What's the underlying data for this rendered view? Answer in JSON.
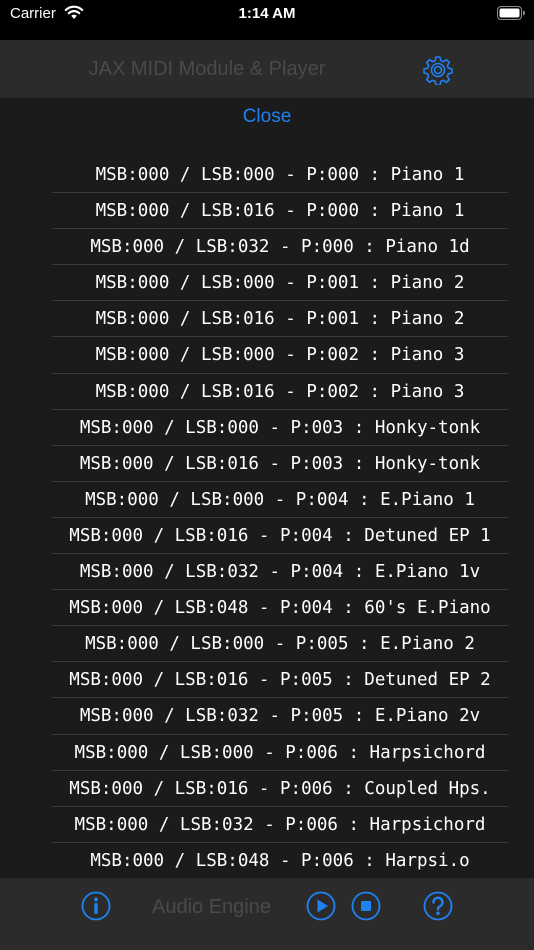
{
  "status_bar": {
    "carrier": "Carrier",
    "time": "1:14 AM"
  },
  "navbar": {
    "title": "JAX MIDI Module & Player"
  },
  "sheet": {
    "close_label": "Close",
    "items": [
      "MSB:000 / LSB:000 - P:000 : Piano 1",
      "MSB:000 / LSB:016 - P:000 : Piano 1",
      "MSB:000 / LSB:032 - P:000 : Piano 1d",
      "MSB:000 / LSB:000 - P:001 : Piano 2",
      "MSB:000 / LSB:016 - P:001 : Piano 2",
      "MSB:000 / LSB:000 - P:002 : Piano 3",
      "MSB:000 / LSB:016 - P:002 : Piano 3",
      "MSB:000 / LSB:000 - P:003 : Honky-tonk",
      "MSB:000 / LSB:016 - P:003 : Honky-tonk",
      "MSB:000 / LSB:000 - P:004 : E.Piano 1",
      "MSB:000 / LSB:016 - P:004 : Detuned EP 1",
      "MSB:000 / LSB:032 - P:004 : E.Piano 1v",
      "MSB:000 / LSB:048 - P:004 : 60's E.Piano",
      "MSB:000 / LSB:000 - P:005 : E.Piano 2",
      "MSB:000 / LSB:016 - P:005 : Detuned EP 2",
      "MSB:000 / LSB:032 - P:005 : E.Piano 2v",
      "MSB:000 / LSB:000 - P:006 : Harpsichord",
      "MSB:000 / LSB:016 - P:006 : Coupled Hps.",
      "MSB:000 / LSB:032 - P:006 : Harpsichord",
      "MSB:000 / LSB:048 - P:006 : Harpsi.o"
    ]
  },
  "toolbar": {
    "engine_label": "Audio Engine"
  },
  "colors": {
    "accent": "#1e82f2",
    "dimmed_text": "#4a4a4a",
    "sheet_bg": "#1b1b1b",
    "bar_bg": "#2b2b2b"
  },
  "icons": [
    "wifi-icon",
    "battery-icon",
    "gear-icon",
    "info-icon",
    "play-icon",
    "stop-icon",
    "help-icon"
  ]
}
